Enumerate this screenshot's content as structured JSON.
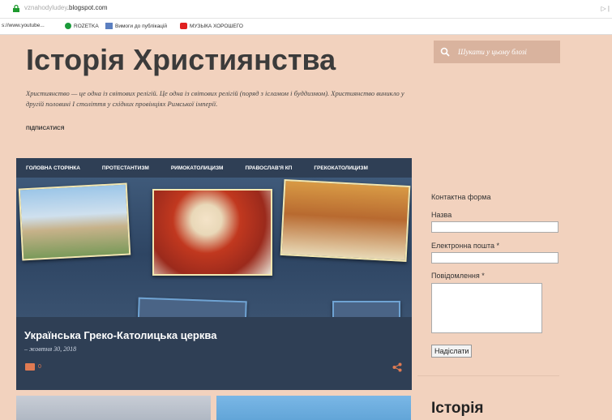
{
  "browser": {
    "address": {
      "domain_dim": "vznahodyludey",
      "domain_main": ".blogspot.com"
    },
    "bookmarks": [
      {
        "label": "s://www.youtube...",
        "icon": "none"
      },
      {
        "label": "ROZETKA",
        "icon": "rozetka-icon",
        "color": "#1a9a3a"
      },
      {
        "label": "Вимоги до публікацій",
        "icon": "document-icon",
        "color": "#5b7fc0"
      },
      {
        "label": "МУЗЫКА ХОРОШЕГО",
        "icon": "youtube-icon",
        "color": "#e02020"
      }
    ],
    "extension": "▷ |"
  },
  "blog": {
    "title": "Історія Християнства",
    "description": "Християнство — це одна із світових релігій. Це одна із світових релігій (поряд з ісламом і буддизмом). Християнство виникло у другій половині I століття у східних провінціях Римської імперії.",
    "subscribe": "ПІДПИСАТИСЯ",
    "search_placeholder": "Шукати у цьому блозі"
  },
  "nav": [
    "ГОЛОВНА СТОРІНКА",
    "ПРОТЕСТАНТИЗМ",
    "РИМОКАТОЛИЦИЗМ",
    "ПРАВОСЛАВ'Я КП",
    "ГРЕКОКАТОЛИЦИЗМ"
  ],
  "post": {
    "title": "Українська Греко-Католицька церква",
    "date": "– жовтня 30, 2018",
    "comments": "0"
  },
  "contact_form": {
    "heading": "Контактна форма",
    "name_label": "Назва",
    "email_label": "Електронна пошта *",
    "message_label": "Повідомлення *",
    "submit": "Надіслати"
  },
  "sidebar_title": "Історія",
  "colors": {
    "background": "#f2d2be",
    "nav": "#2f3f55",
    "accent": "#e07a52"
  }
}
